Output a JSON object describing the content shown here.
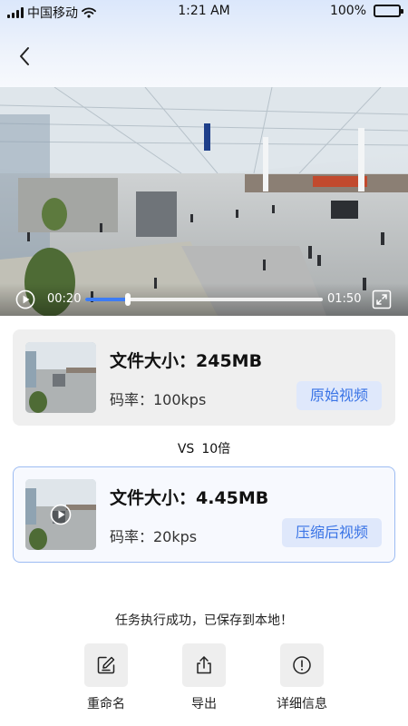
{
  "status_bar": {
    "carrier": "中国移动",
    "time": "1:21 AM",
    "battery": "100%",
    "icons": [
      "signal-icon",
      "wifi-icon",
      "battery-icon"
    ]
  },
  "nav": {
    "back_icon": "chevron-left-icon"
  },
  "player": {
    "current_time": "00:20",
    "total_time": "01:50",
    "progress_fraction": 0.18,
    "play_icon": "play-icon",
    "fullscreen_icon": "fullscreen-icon"
  },
  "original": {
    "size_label": "文件大小：245MB",
    "bitrate_label": "码率：100kps",
    "button": "原始视频"
  },
  "comparison": {
    "vs": "VS",
    "ratio": "10倍"
  },
  "compressed": {
    "size_label": "文件大小：4.45MB",
    "bitrate_label": "码率：20kps",
    "button": "压缩后视频"
  },
  "message": "任务执行成功，已保存到本地！",
  "actions": [
    {
      "label": "重命名",
      "icon": "edit-icon"
    },
    {
      "label": "导出",
      "icon": "share-icon"
    },
    {
      "label": "详细信息",
      "icon": "info-icon"
    }
  ],
  "colors": {
    "accent": "#3a74e6",
    "accent_bg": "#dfe8fb",
    "progress": "#3d7cf4"
  }
}
